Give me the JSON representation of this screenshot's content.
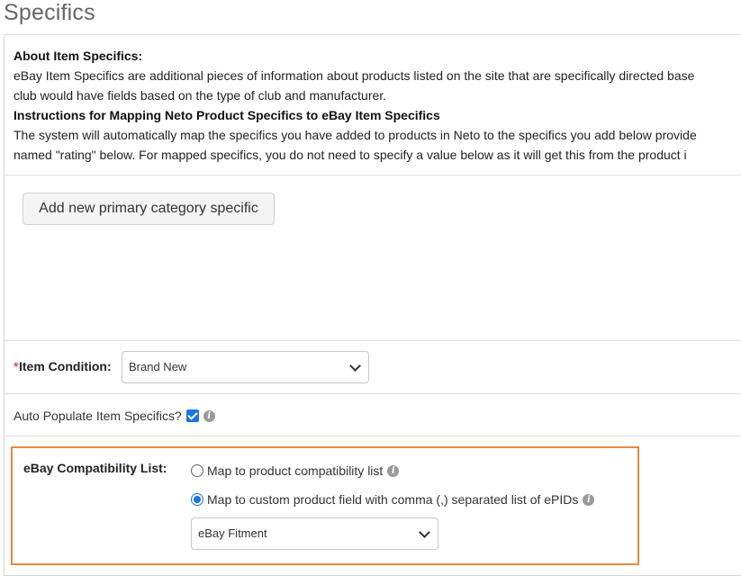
{
  "page": {
    "title": "Specifics"
  },
  "about": {
    "heading": "About Item Specifics:",
    "line1": "eBay Item Specifics are additional pieces of information about products listed on the site that are specifically directed base",
    "line2": "club would have fields based on the type of club and manufacturer."
  },
  "instructions": {
    "heading": "Instructions for Mapping Neto Product Specifics to eBay Item Specifics",
    "line1": "The system will automatically map the specifics you have added to products in Neto to the specifics you add below provide",
    "line2": "named \"rating\" below. For mapped specifics, you do not need to specify a value below as it will get this from the product i"
  },
  "actions": {
    "add_primary_specific": "Add new primary category specific"
  },
  "item_condition": {
    "required_mark": "*",
    "label": "Item Condition:",
    "selected": "Brand New"
  },
  "auto_populate": {
    "label": "Auto Populate Item Specifics?",
    "checked": true
  },
  "compatibility": {
    "label": "eBay Compatibility List:",
    "options": [
      {
        "label": "Map to product compatibility list",
        "checked": false
      },
      {
        "label": "Map to custom product field with comma (,) separated list of ePIDs",
        "checked": true
      }
    ],
    "field_selected": "eBay Fitment"
  },
  "colors": {
    "accent": "#1a73e8",
    "highlight_border": "#e8883a",
    "required": "#d9534f"
  }
}
